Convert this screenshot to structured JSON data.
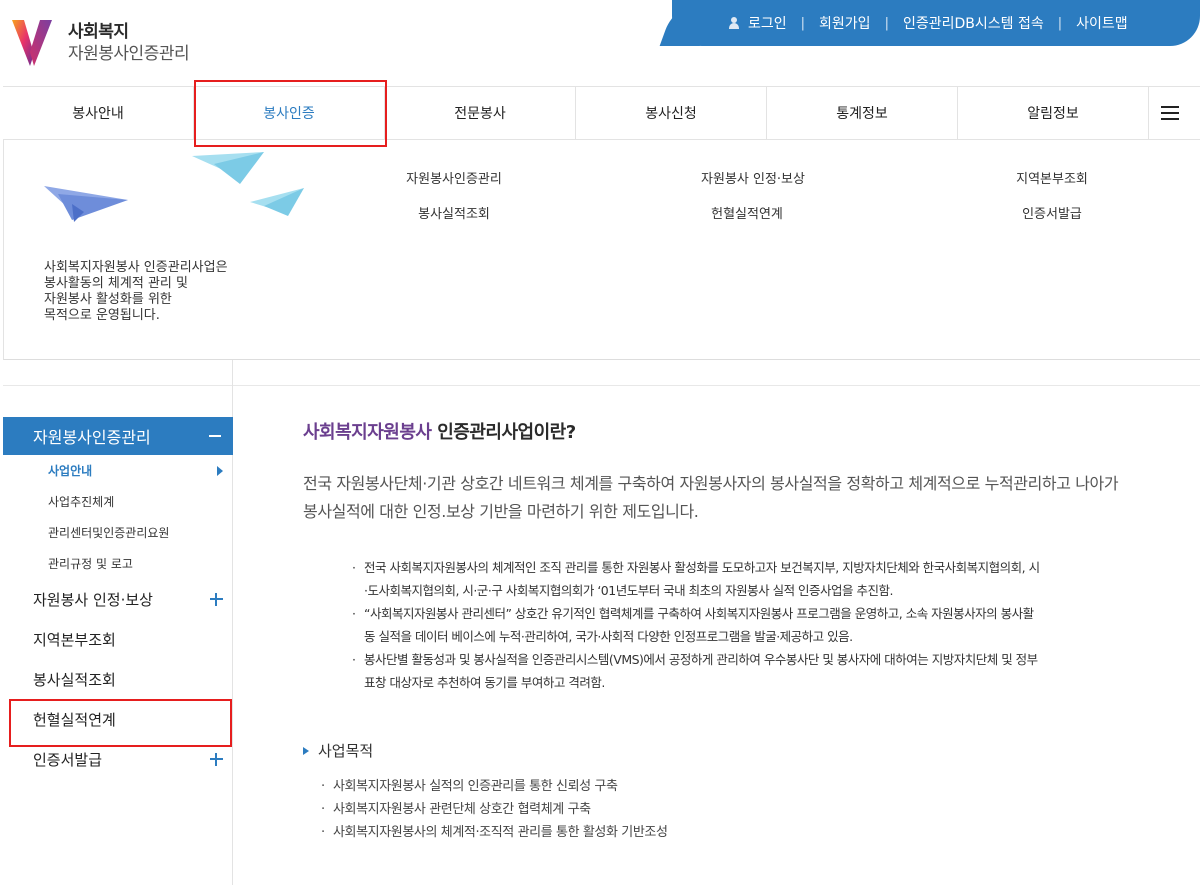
{
  "brand": {
    "title": "사회복지",
    "subtitle": "자원봉사인증관리",
    "colors": {
      "primary": "#2c7cc0",
      "accent_purple": "#6b3f8f",
      "highlight": "#e61e1e"
    }
  },
  "util_nav": {
    "login": "로그인",
    "join": "회원가입",
    "db_system": "인증관리DB시스템 접속",
    "sitemap": "사이트맵",
    "login_icon": "user-icon"
  },
  "gnb": {
    "items": [
      "봉사안내",
      "봉사인증",
      "전문봉사",
      "봉사신청",
      "통계정보",
      "알림정보"
    ],
    "active": "봉사인증",
    "menu_icon": "hamburger-icon"
  },
  "mega": {
    "description_lines": [
      "사회복지자원봉사 인증관리사업은",
      "봉사활동의 체계적 관리 및",
      "자원봉사 활성화를 위한",
      "목적으로 운영됩니다."
    ],
    "links": [
      "자원봉사인증관리",
      "자원봉사 인정·보상",
      "지역본부조회",
      "봉사실적조회",
      "헌혈실적연계",
      "인증서발급"
    ]
  },
  "lnb": {
    "header": "자원봉사인증관리",
    "sub_items": [
      "사업안내",
      "사업추진체계",
      "관리센터및인증관리요원",
      "관리규정 및 로고"
    ],
    "main_items": [
      "자원봉사 인정·보상",
      "지역본부조회",
      "봉사실적조회",
      "헌혈실적연계",
      "인증서발급"
    ]
  },
  "content": {
    "title_highlight": "사회복지자원봉사",
    "title_rest": " 인증관리사업이란?",
    "intro_lines": [
      "전국 자원봉사단체·기관 상호간 네트워크 체계를 구축하여 자원봉사자의 봉사실적을 정확하고 체계적으로 누적관리하고 나아가",
      "봉사실적에 대한 인정.보상 기반을 마련하기 위한 제도입니다."
    ],
    "bullets": [
      "전국 사회복지자원봉사의 체계적인 조직 관리를 통한 자원봉사 활성화를 도모하고자 보건복지부, 지방자치단체와 한국사회복지협의회, 시",
      "·도사회복지협의회, 시·군·구 사회복지협의회가 ‘01년도부터 국내 최초의 자원봉사 실적 인증사업을 추진함.",
      "“사회복지자원봉사 관리센터” 상호간 유기적인 협력체계를 구축하여 사회복지자원봉사 프로그램을 운영하고, 소속 자원봉사자의 봉사활",
      "동 실적을 데이터 베이스에 누적·관리하여, 국가·사회적 다양한 인정프로그램을 발굴·제공하고 있음.",
      "봉사단별 활동성과 및 봉사실적을 인증관리시스템(VMS)에서 공정하게 관리하여 우수봉사단 및 봉사자에 대하여는 지방자치단체 및 정부",
      "표창 대상자로 추천하여 동기를 부여하고 격려함."
    ],
    "section_title": "사업목적",
    "goals": [
      "사회복지자원봉사 실적의 인증관리를 통한 신뢰성 구축",
      "사회복지자원봉사 관련단체 상호간 협력체계 구축",
      "사회복지자원봉사의 체계적·조직적 관리를 통한 활성화 기반조성"
    ]
  }
}
